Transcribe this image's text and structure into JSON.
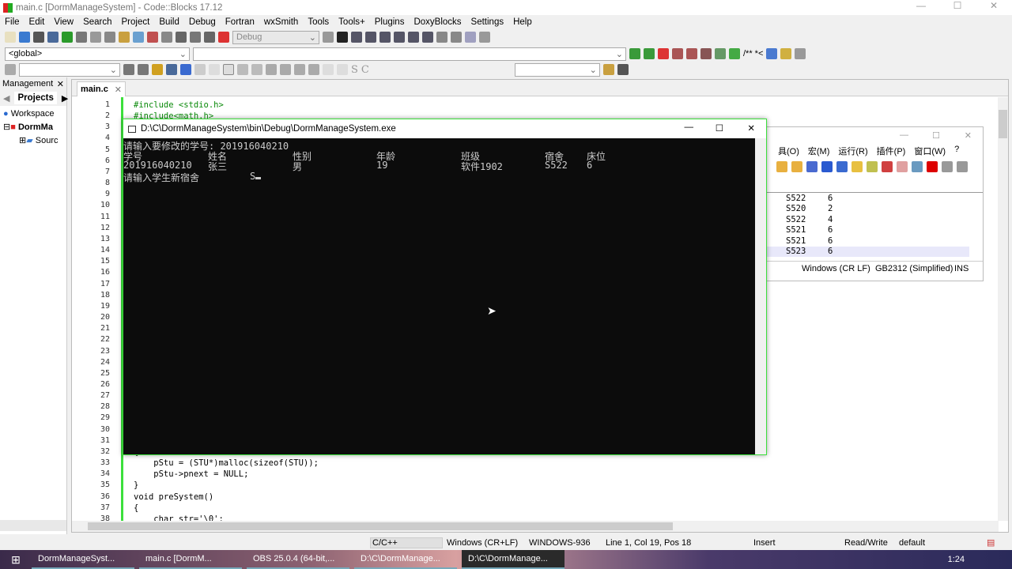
{
  "window": {
    "title": "main.c [DormManageSystem] - Code::Blocks 17.12"
  },
  "menu": [
    "File",
    "Edit",
    "View",
    "Search",
    "Project",
    "Build",
    "Debug",
    "Fortran",
    "wxSmith",
    "Tools",
    "Tools+",
    "Plugins",
    "DoxyBlocks",
    "Settings",
    "Help"
  ],
  "toolbar": {
    "build_target": "Debug",
    "scope": "<global>"
  },
  "management": {
    "title": "Management",
    "tab": "Projects",
    "tree": [
      "Workspace",
      "DormMa",
      "Sourc"
    ]
  },
  "editor": {
    "tab": "main.c",
    "lines": [
      {
        "n": 1,
        "code": "#include <stdio.h>"
      },
      {
        "n": 2,
        "code": "#include<math.h>"
      },
      {
        "n": 32,
        "code": "{"
      },
      {
        "n": 33,
        "code": "    pStu = (STU*)malloc(sizeof(STU));"
      },
      {
        "n": 34,
        "code": "    pStu->pnext = NULL;"
      },
      {
        "n": 35,
        "code": "}"
      },
      {
        "n": 36,
        "code": "void preSystem()"
      },
      {
        "n": 37,
        "code": "{"
      },
      {
        "n": 38,
        "code": "    char str='\\0';"
      }
    ]
  },
  "console": {
    "title": "D:\\C\\DormManageSystem\\bin\\Debug\\DormManageSystem.exe",
    "prompt1": "请输入要修改的学号:  201916040210",
    "headers": [
      "学号",
      "姓名",
      "性别",
      "年龄",
      "班级",
      "宿舍",
      "床位"
    ],
    "row": [
      "201916040210",
      "张三",
      "男",
      "19",
      "软件1902",
      "S522",
      "6"
    ],
    "prompt2": "请输入学生新宿舍",
    "input": "S"
  },
  "bg_window": {
    "menu": [
      "具(O)",
      "宏(M)",
      "运行(R)",
      "插件(P)",
      "窗口(W)",
      "?"
    ],
    "rows": [
      [
        "S522",
        "6"
      ],
      [
        "S520",
        "2"
      ],
      [
        "S522",
        "4"
      ],
      [
        "S521",
        "6"
      ],
      [
        "S521",
        "6"
      ],
      [
        "S523",
        "6"
      ]
    ],
    "status": [
      "Windows (CR LF)",
      "GB2312 (Simplified)",
      "INS"
    ]
  },
  "statusbar": {
    "language": "C/C++",
    "eol": "Windows (CR+LF)",
    "encoding": "WINDOWS-936",
    "position": "Line 1, Col 19, Pos 18",
    "mode": "Insert",
    "access": "Read/Write",
    "profile": "default"
  },
  "taskbar": {
    "items": [
      "DormManageSyst...",
      "main.c [DormM...",
      "OBS 25.0.4 (64-bit,...",
      "D:\\C\\DormManage...",
      "D:\\C\\DormManage..."
    ],
    "time": "1:24"
  }
}
